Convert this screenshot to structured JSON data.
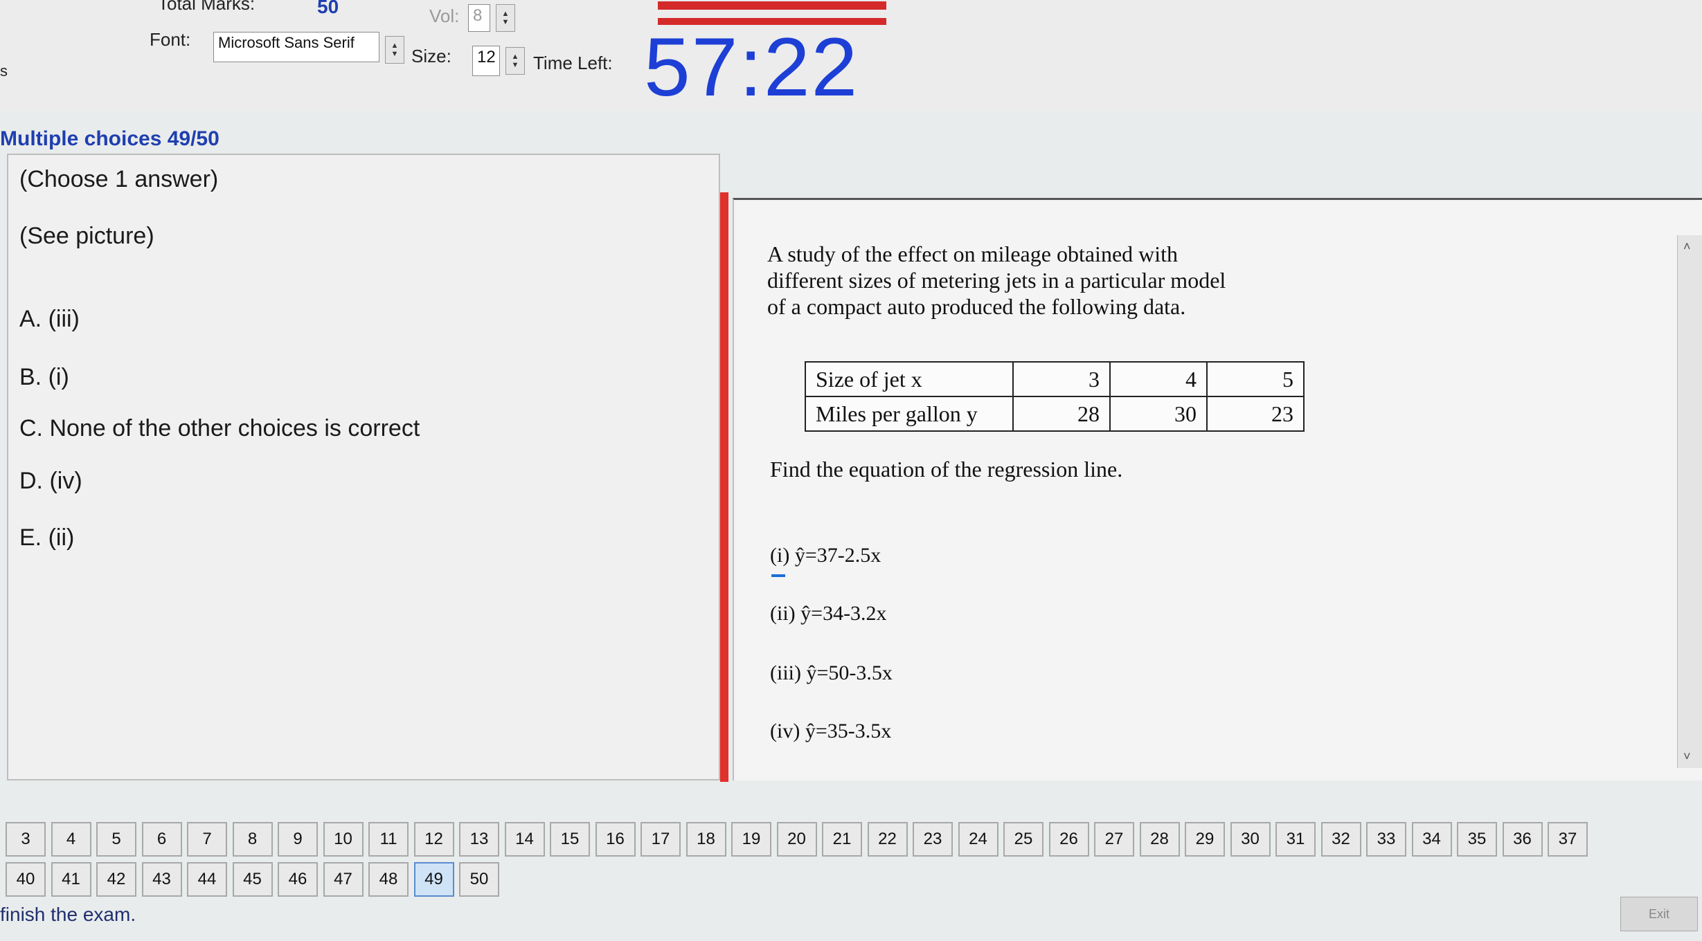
{
  "header": {
    "total_marks_label": "Total Marks:",
    "total_marks_value": "50",
    "vol_label": "Vol:",
    "vol_value": "8",
    "font_label": "Font:",
    "font_value": "Microsoft Sans Serif",
    "size_label": "Size:",
    "size_value": "12",
    "time_left_label": "Time Left:",
    "timer": "57:22",
    "edge_glyph": "s"
  },
  "section_title": "Multiple choices 49/50",
  "question": {
    "instruction": "(Choose 1 answer)",
    "see_picture": "(See picture)",
    "choices": [
      {
        "letter": "A.",
        "text": "(iii)"
      },
      {
        "letter": "B.",
        "text": "(i)"
      },
      {
        "letter": "C.",
        "text": "None of the other choices is correct"
      },
      {
        "letter": "D.",
        "text": "(iv)"
      },
      {
        "letter": "E.",
        "text": "(ii)"
      }
    ]
  },
  "picture": {
    "prompt_lines": [
      "A study of the effect on mileage obtained with",
      "different sizes of metering jets in a particular model",
      "of a compact auto produced the following data."
    ],
    "table": {
      "rows": [
        {
          "label": "Size of jet x",
          "values": [
            "3",
            "4",
            "5"
          ]
        },
        {
          "label": "Miles per gallon y",
          "values": [
            "28",
            "30",
            "23"
          ]
        }
      ]
    },
    "find": "Find the equation of the regression line.",
    "options": [
      "(i) ŷ=37-2.5x",
      "(ii) ŷ=34-3.2x",
      "(iii) ŷ=50-3.5x",
      "(iv) ŷ=35-3.5x"
    ]
  },
  "nav": {
    "row1": [
      "3",
      "4",
      "5",
      "6",
      "7",
      "8",
      "9",
      "10",
      "11",
      "12",
      "13",
      "14",
      "15",
      "16",
      "17",
      "18",
      "19",
      "20",
      "21",
      "22",
      "23",
      "24",
      "25",
      "26",
      "27",
      "28",
      "29",
      "30",
      "31",
      "32",
      "33",
      "34",
      "35",
      "36",
      "37"
    ],
    "row2": [
      "40",
      "41",
      "42",
      "43",
      "44",
      "45",
      "46",
      "47",
      "48",
      "49",
      "50"
    ]
  },
  "footer": {
    "finish_text": "finish the exam.",
    "exit_label": "Exit"
  },
  "colors": {
    "accent_blue": "#1d3fd6",
    "red_strip": "#e0312b"
  }
}
